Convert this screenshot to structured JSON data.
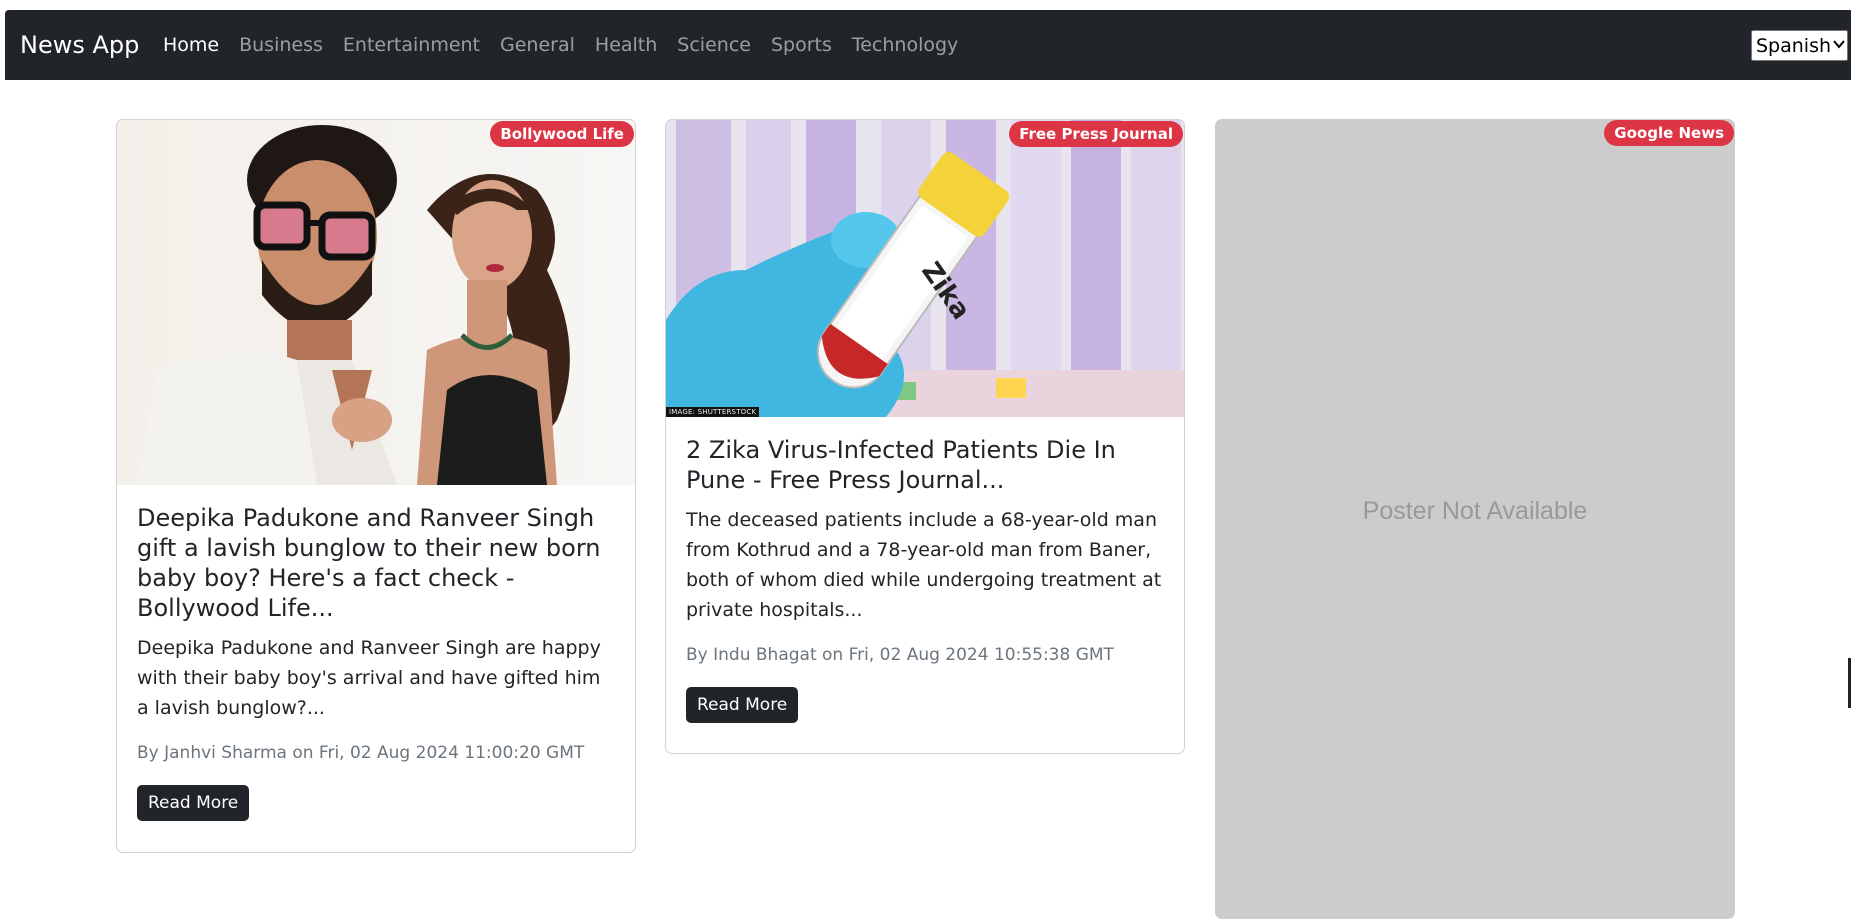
{
  "app": {
    "brand": "News App"
  },
  "nav": {
    "items": [
      {
        "label": "Home",
        "active": true
      },
      {
        "label": "Business",
        "active": false
      },
      {
        "label": "Entertainment",
        "active": false
      },
      {
        "label": "General",
        "active": false
      },
      {
        "label": "Health",
        "active": false
      },
      {
        "label": "Science",
        "active": false
      },
      {
        "label": "Sports",
        "active": false
      },
      {
        "label": "Technology",
        "active": false
      }
    ],
    "language_selected": "Spanish"
  },
  "colors": {
    "navbar_bg": "#212529",
    "badge_bg": "#dc3545",
    "button_bg": "#212529",
    "poster_placeholder_bg": "#cccccc"
  },
  "cards": [
    {
      "source": "Bollywood Life",
      "image": "couple-photo",
      "title": "Deepika Padukone and Ranveer Singh gift a lavish bunglow to their new born baby boy? Here's a fact check - Bollywood Life...",
      "description": "Deepika Padukone and Ranveer Singh are happy with their baby boy's arrival and have gifted him a lavish bunglow?...",
      "meta": "By Janhvi Sharma on Fri, 02 Aug 2024 11:00:20 GMT",
      "button_label": "Read More"
    },
    {
      "source": "Free Press Journal",
      "image": "zika-test-tube-photo",
      "image_credit": "IMAGE: SHUTTERSTOCK",
      "title": "2 Zika Virus-Infected Patients Die In Pune - Free Press Journal...",
      "description": "The deceased patients include a 68-year-old man from Kothrud and a 78-year-old man from Baner, both of whom died while undergoing treatment at private hospitals...",
      "meta": "By Indu Bhagat on Fri, 02 Aug 2024 10:55:38 GMT",
      "button_label": "Read More"
    },
    {
      "source": "Google News",
      "image_placeholder": "Poster Not Available"
    }
  ]
}
